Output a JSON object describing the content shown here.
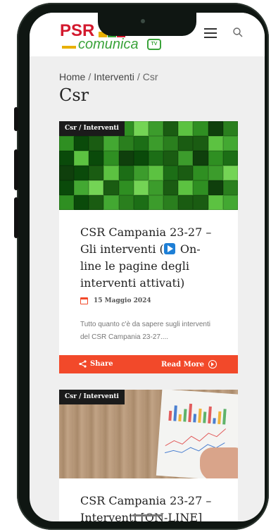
{
  "header": {
    "logo_primary": "PSR",
    "logo_secondary": "comunica",
    "logo_badge": "TV",
    "menu_icon": "hamburger-icon",
    "search_icon": "search-icon"
  },
  "breadcrumb": {
    "home": "Home",
    "section": "Interventi",
    "current": "Csr",
    "separator": "/"
  },
  "page": {
    "title": "Csr"
  },
  "posts": [
    {
      "category": "Csr / Interventi",
      "title_part1": "CSR Campania 23-27 – Gli interventi (",
      "title_part2": " On-line le pagine degli interventi attivati)",
      "date": "15 Maggio 2024",
      "excerpt": "Tutto quanto c'è da sapere sugli interventi del CSR Campania 23-27....",
      "share_label": "Share",
      "read_more_label": "Read More"
    },
    {
      "category": "Csr / Interventi",
      "title_part1": "CSR Campania 23-27 –",
      "title_part2": "Interventi [ON-LINE]"
    }
  ],
  "colors": {
    "accent": "#f2492a",
    "logo_red": "#d3192e",
    "logo_green": "#3aa33a",
    "category_bg": "#1b1b1b"
  }
}
